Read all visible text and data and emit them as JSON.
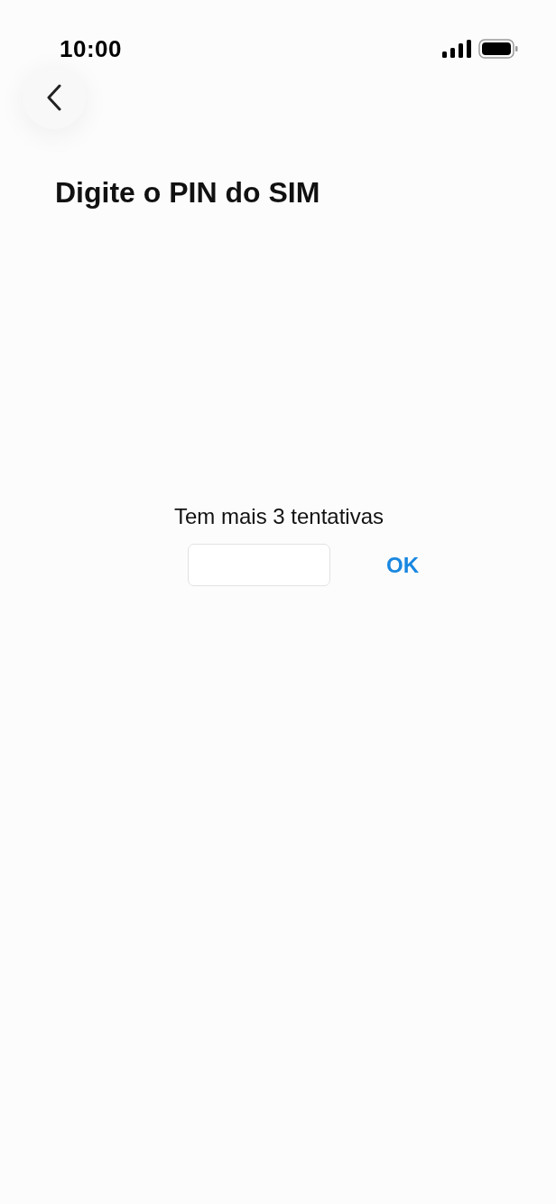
{
  "status_bar": {
    "time": "10:00"
  },
  "title": "Digite o PIN do SIM",
  "message": "Tem mais 3 tentativas",
  "ok_button": {
    "label": "OK"
  }
}
